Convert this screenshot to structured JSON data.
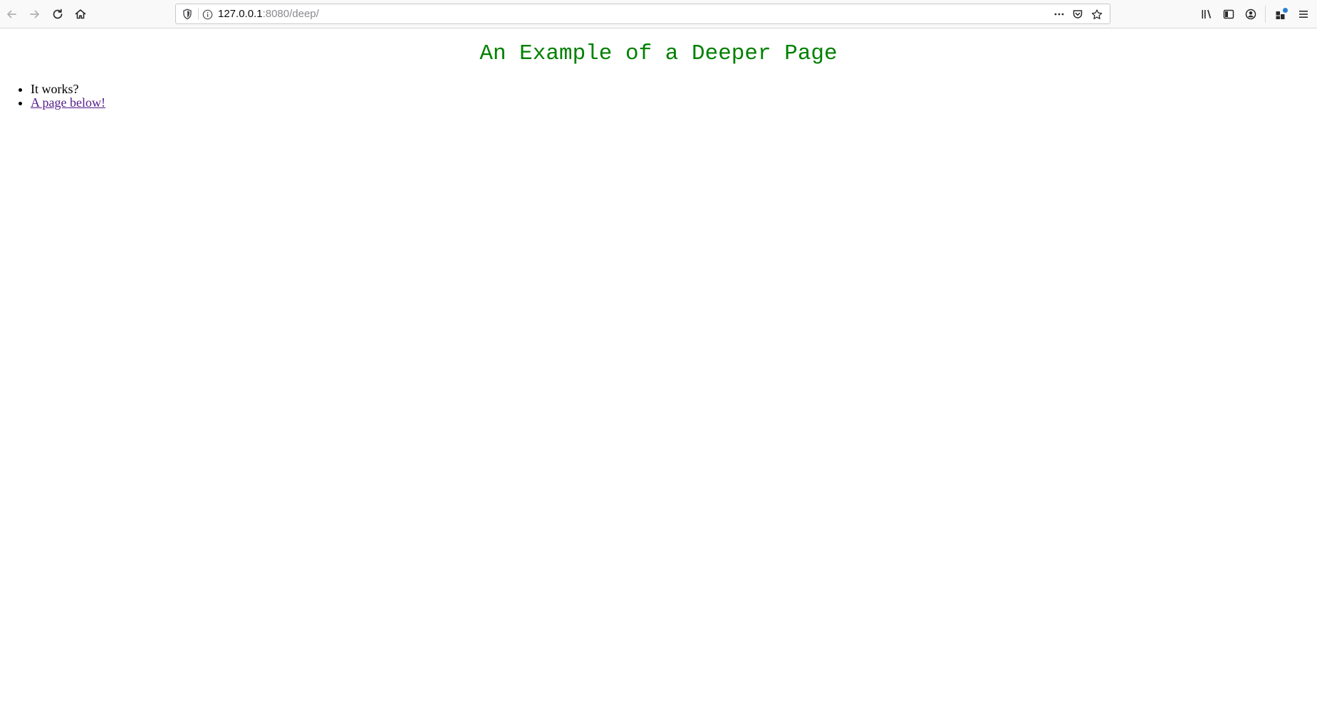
{
  "browser": {
    "url": {
      "host": "127.0.0.1",
      "rest": ":8080/deep/"
    },
    "icons": {
      "back": "arrow-left-icon",
      "forward": "arrow-right-icon",
      "reload": "reload-icon",
      "home": "home-icon",
      "tracking_protection": "shield-icon",
      "site_info": "info-icon",
      "page_actions": "ellipsis-icon",
      "pocket": "pocket-icon",
      "bookmark": "star-icon",
      "library": "library-icon",
      "sidebar": "sidebar-icon",
      "account": "account-icon",
      "extensions": "extensions-icon",
      "menu": "hamburger-menu-icon"
    },
    "colors": {
      "toolbar_bg": "#f9f9fa",
      "notification_dot": "#2a7fd4"
    }
  },
  "page": {
    "title": "An Example of a Deeper Page",
    "title_color": "#008000",
    "items": [
      {
        "text": "It works?",
        "is_link": false
      },
      {
        "text": "A page below!",
        "is_link": true,
        "link_color": "#551a8b"
      }
    ]
  }
}
